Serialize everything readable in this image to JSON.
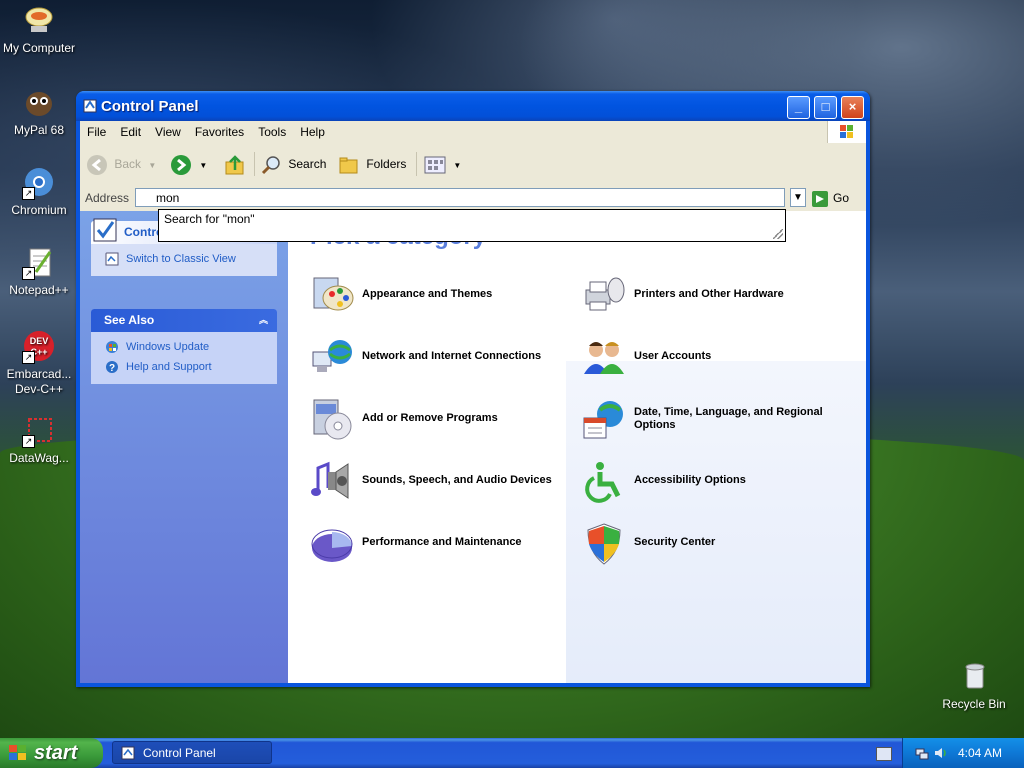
{
  "desktop": {
    "icons": [
      {
        "label": "My Computer",
        "icon": "my-computer-icon"
      },
      {
        "label": "MyPal 68",
        "icon": "mypal-icon"
      },
      {
        "label": "Chromium",
        "icon": "chromium-icon"
      },
      {
        "label": "Notepad++",
        "icon": "notepadpp-icon"
      },
      {
        "label": "Embarcad... Dev-C++",
        "icon": "devcpp-icon"
      },
      {
        "label": "DataWag...",
        "icon": "datawag-icon"
      },
      {
        "label": "Recycle Bin",
        "icon": "recycle-bin-icon"
      }
    ]
  },
  "window": {
    "title": "Control Panel",
    "buttons": {
      "minimize": "_",
      "maximize": "□",
      "close": "×"
    }
  },
  "menu": [
    "File",
    "Edit",
    "View",
    "Favorites",
    "Tools",
    "Help"
  ],
  "toolbar": {
    "back_label": "Back",
    "search_label": "Search",
    "folders_label": "Folders"
  },
  "address": {
    "label": "Address",
    "value": "mon",
    "go_label": "Go",
    "suggestion": "Search for \"mon\""
  },
  "sidebar": {
    "control_panel": {
      "title": "Control Panel",
      "links": [
        "Switch to Classic View"
      ]
    },
    "see_also": {
      "title": "See Also",
      "links": [
        "Windows Update",
        "Help and Support"
      ]
    }
  },
  "main": {
    "heading": "Pick a category",
    "categories_left": [
      {
        "label": "Appearance and Themes",
        "icon": "appearance-themes-icon"
      },
      {
        "label": "Network and Internet Connections",
        "icon": "network-icon"
      },
      {
        "label": "Add or Remove Programs",
        "icon": "add-remove-programs-icon"
      },
      {
        "label": "Sounds, Speech, and Audio Devices",
        "icon": "sounds-icon"
      },
      {
        "label": "Performance and Maintenance",
        "icon": "performance-icon"
      }
    ],
    "categories_right": [
      {
        "label": "Printers and Other Hardware",
        "icon": "printers-icon"
      },
      {
        "label": "User Accounts",
        "icon": "user-accounts-icon"
      },
      {
        "label": "Date, Time, Language, and Regional Options",
        "icon": "date-time-icon"
      },
      {
        "label": "Accessibility Options",
        "icon": "accessibility-icon"
      },
      {
        "label": "Security Center",
        "icon": "security-center-icon"
      }
    ]
  },
  "taskbar": {
    "start_label": "start",
    "task_label": "Control Panel",
    "clock": "4:04 AM"
  },
  "colors": {
    "xp_blue": "#0154e0",
    "link_blue": "#215dc6",
    "heading_blue": "#5a7edc",
    "start_green": "#3a9a3a"
  }
}
